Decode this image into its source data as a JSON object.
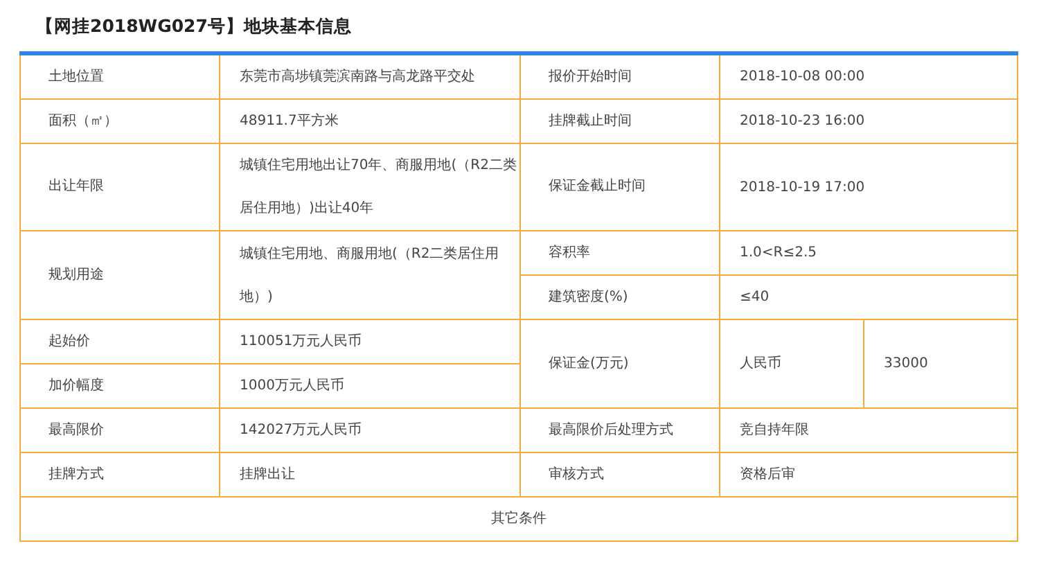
{
  "title": "【网挂2018WG027号】地块基本信息",
  "table": {
    "rows": [
      {
        "cells": [
          {
            "kind": "label",
            "text": [
              "土地位置"
            ]
          },
          {
            "kind": "value",
            "text": [
              "东莞市高埗镇莞滨南路与高龙路平交处"
            ]
          },
          {
            "kind": "label",
            "text": [
              "报价开始时间"
            ]
          },
          {
            "kind": "value",
            "colspan": 2,
            "text": [
              "2018-10-08 00:00"
            ]
          }
        ]
      },
      {
        "cells": [
          {
            "kind": "label",
            "text": [
              "面积（㎡）"
            ]
          },
          {
            "kind": "value",
            "text": [
              "48911.7平方米"
            ]
          },
          {
            "kind": "label",
            "text": [
              "挂牌截止时间"
            ]
          },
          {
            "kind": "value",
            "colspan": 2,
            "text": [
              "2018-10-23 16:00"
            ]
          }
        ]
      },
      {
        "cells": [
          {
            "kind": "label",
            "text": [
              "出让年限"
            ]
          },
          {
            "kind": "value",
            "text": [
              "城镇住宅用地出让70年、商服用地(（R2二类",
              "居住用地）)出让40年"
            ]
          },
          {
            "kind": "label",
            "text": [
              "保证金截止时间"
            ]
          },
          {
            "kind": "value",
            "colspan": 2,
            "text": [
              "2018-10-19 17:00"
            ]
          }
        ]
      },
      {
        "cells": [
          {
            "kind": "label",
            "rowspan": 2,
            "text": [
              "规划用途"
            ]
          },
          {
            "kind": "value",
            "rowspan": 2,
            "text": [
              "城镇住宅用地、商服用地(（R2二类居住用",
              "地）)"
            ]
          },
          {
            "kind": "label",
            "text": [
              "容积率"
            ]
          },
          {
            "kind": "value",
            "colspan": 2,
            "text": [
              "1.0<R≤2.5"
            ]
          }
        ]
      },
      {
        "cells": [
          {
            "kind": "label",
            "text": [
              "建筑密度(%)"
            ]
          },
          {
            "kind": "value",
            "colspan": 2,
            "text": [
              "≤40"
            ]
          }
        ]
      },
      {
        "cells": [
          {
            "kind": "label",
            "text": [
              "起始价"
            ]
          },
          {
            "kind": "value",
            "text": [
              "110051万元人民币"
            ]
          },
          {
            "kind": "label",
            "rowspan": 2,
            "text": [
              "保证金(万元)"
            ]
          },
          {
            "kind": "value",
            "rowspan": 2,
            "text": [
              "人民币"
            ]
          },
          {
            "kind": "value",
            "rowspan": 2,
            "text": [
              "33000"
            ]
          }
        ]
      },
      {
        "cells": [
          {
            "kind": "label",
            "text": [
              "加价幅度"
            ]
          },
          {
            "kind": "value",
            "text": [
              "1000万元人民币"
            ]
          }
        ]
      },
      {
        "cells": [
          {
            "kind": "label",
            "text": [
              "最高限价"
            ]
          },
          {
            "kind": "value",
            "text": [
              "142027万元人民币"
            ]
          },
          {
            "kind": "label",
            "text": [
              "最高限价后处理方式"
            ]
          },
          {
            "kind": "value",
            "colspan": 2,
            "text": [
              "竞自持年限"
            ]
          }
        ]
      },
      {
        "cells": [
          {
            "kind": "label",
            "text": [
              "挂牌方式"
            ]
          },
          {
            "kind": "value",
            "text": [
              "挂牌出让"
            ]
          },
          {
            "kind": "label",
            "text": [
              "审核方式"
            ]
          },
          {
            "kind": "value",
            "colspan": 2,
            "text": [
              "资格后审"
            ]
          }
        ]
      },
      {
        "cells": [
          {
            "kind": "footer",
            "colspan": 5,
            "text": [
              "其它条件"
            ]
          }
        ]
      }
    ]
  }
}
